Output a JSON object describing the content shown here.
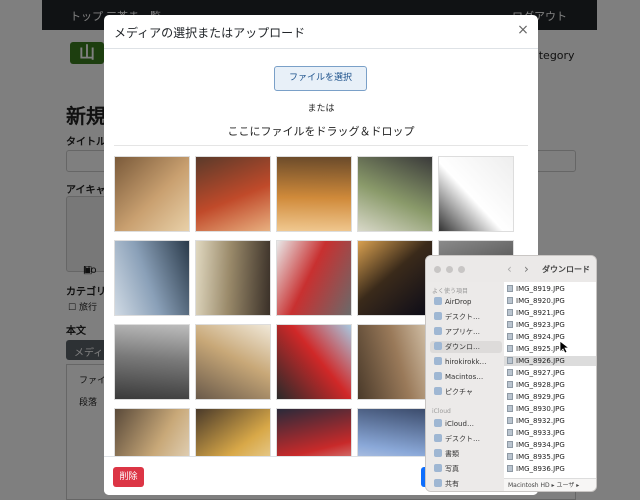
{
  "background": {
    "topbar": {
      "item1": "トップ",
      "item2": "三茶ま一覧",
      "item3": "ログアウト"
    },
    "logo_text": "山",
    "category_text": "ategory",
    "heading": "新規",
    "title_label": "タイトル",
    "eyecatch_label": "アイキャッ",
    "eyecatch_placeholder": "No",
    "category_label": "カテゴリー",
    "category_option": "旅行",
    "body_label": "本文",
    "media_button": "メディ",
    "editor_line1": "ファイ",
    "editor_line2": "段落"
  },
  "modal": {
    "title": "メディアの選択またはアップロード",
    "close_symbol": "×",
    "upload_button": "ファイルを選択",
    "or_text": "または",
    "drop_text": "ここにファイルをドラッグ＆ドロップ",
    "delete_button": "削除",
    "thumbnails": [
      {
        "name": "buffet-trays",
        "colors": [
          "#7a5a3a",
          "#c9a070",
          "#e8d0a8"
        ]
      },
      {
        "name": "fish-platter",
        "colors": [
          "#5a3a2a",
          "#c04a2a",
          "#e8b080"
        ]
      },
      {
        "name": "breakfast-buffet",
        "colors": [
          "#6a4a2a",
          "#d08a3a",
          "#f0c890"
        ]
      },
      {
        "name": "bowl-dish",
        "colors": [
          "#3a3a3a",
          "#8a9a6a",
          "#d8d8c8"
        ]
      },
      {
        "name": "coupon-card",
        "colors": [
          "#eeeeee",
          "#ffffff",
          "#333333"
        ]
      },
      {
        "name": "steaming-pot",
        "colors": [
          "#2a3a4a",
          "#8aa0b8",
          "#d0dae4"
        ]
      },
      {
        "name": "soba-noodles",
        "colors": [
          "#3a3028",
          "#9a8a6a",
          "#e0d8c0"
        ]
      },
      {
        "name": "vending-machine",
        "colors": [
          "#6a6a6a",
          "#c83030",
          "#e8e8e8"
        ]
      },
      {
        "name": "night-city-lights",
        "colors": [
          "#0a0a18",
          "#3a2a1a",
          "#d8a050"
        ]
      },
      {
        "name": "dark-photo",
        "colors": [
          "#2a2a2a",
          "#5a5a5a",
          "#8a8a8a"
        ]
      },
      {
        "name": "ticket-machine",
        "colors": [
          "#3a3a3a",
          "#7a7a7a",
          "#bdbdbd"
        ]
      },
      {
        "name": "station-kiosk",
        "colors": [
          "#6a5a4a",
          "#c8a878",
          "#f0e8d8"
        ]
      },
      {
        "name": "drink-vending",
        "colors": [
          "#2a2a2a",
          "#d02828",
          "#a8c8e0"
        ]
      },
      {
        "name": "hall-interior",
        "colors": [
          "#4a3a2a",
          "#9a7a5a",
          "#d8c8b0"
        ]
      },
      {
        "name": "shop-corridor",
        "colors": [
          "#3a4a5a",
          "#8a9aaa",
          "#d8e0e8"
        ]
      },
      {
        "name": "store-front",
        "colors": [
          "#5a4a3a",
          "#c8a878",
          "#e8dcc8"
        ]
      },
      {
        "name": "lit-shop",
        "colors": [
          "#4a3a2a",
          "#d8a848",
          "#f0e0b8"
        ]
      },
      {
        "name": "red-sign-shop",
        "colors": [
          "#2a2a3a",
          "#c82a2a",
          "#e0d8d0"
        ]
      },
      {
        "name": "gift-shop",
        "colors": [
          "#3a4a6a",
          "#8aa8d8",
          "#e8e8f0"
        ]
      }
    ]
  },
  "finder": {
    "title": "ダウンロード",
    "sidebar_section_top": "よく使う項目",
    "sidebar_items": [
      "AirDrop",
      "デスクト…",
      "アプリケ…",
      "ダウンロ…",
      "hirokirokk…",
      "Macintos…",
      "ピクチャ"
    ],
    "sidebar_section_cloud": "iCloud",
    "cloud_items": [
      "iCloud…",
      "デスクト…",
      "書類",
      "写真",
      "共有"
    ],
    "files": [
      "IMG_8919.JPG",
      "IMG_8920.JPG",
      "IMG_8921.JPG",
      "IMG_8923.JPG",
      "IMG_8924.JPG",
      "IMG_8925.JPG",
      "IMG_8926.JPG",
      "IMG_8927.JPG",
      "IMG_8928.JPG",
      "IMG_8929.JPG",
      "IMG_8930.JPG",
      "IMG_8932.JPG",
      "IMG_8933.JPG",
      "IMG_8934.JPG",
      "IMG_8935.JPG",
      "IMG_8936.JPG"
    ],
    "selected_file": "IMG_8926.JPG",
    "path_text": "Macintosh HD ▸ ユーザ ▸"
  }
}
